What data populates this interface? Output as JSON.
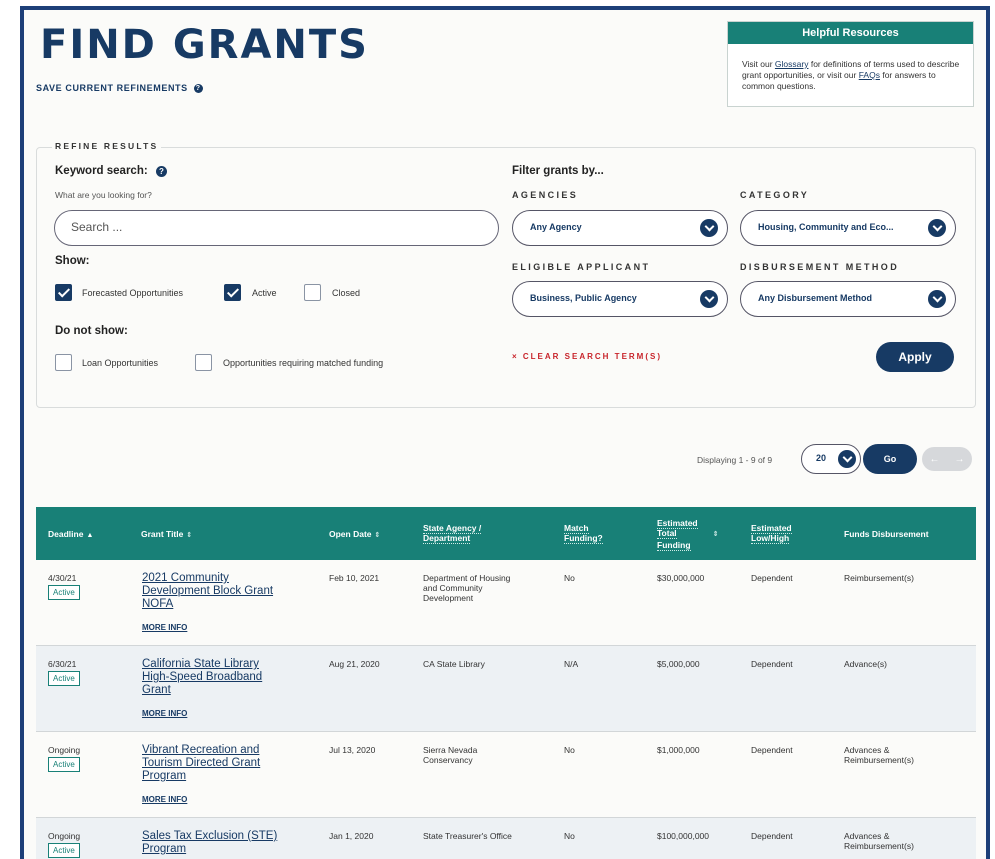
{
  "header": {
    "title": "FIND GRANTS",
    "save_refinements": "SAVE CURRENT REFINEMENTS"
  },
  "resources": {
    "title": "Helpful Resources",
    "text_1": "Visit our ",
    "glossary_link": "Glossary",
    "text_2": " for definitions of terms used to describe grant opportunities, or visit our ",
    "faqs_link": "FAQs",
    "text_3": " for answers to common questions."
  },
  "refine": {
    "legend": "REFINE RESULTS",
    "keyword_label": "Keyword search:",
    "keyword_hint": "What are you looking for?",
    "search_placeholder": "Search ...",
    "show_label": "Show:",
    "show_options": [
      {
        "label": "Forecasted Opportunities",
        "checked": true
      },
      {
        "label": "Active",
        "checked": true
      },
      {
        "label": "Closed",
        "checked": false
      }
    ],
    "do_not_show_label": "Do not show:",
    "do_not_show_options": [
      {
        "label": "Loan Opportunities",
        "checked": false
      },
      {
        "label": "Opportunities requiring matched funding",
        "checked": false
      }
    ],
    "filter_label": "Filter grants by...",
    "agencies_label": "AGENCIES",
    "agencies_value": "Any Agency",
    "category_label": "CATEGORY",
    "category_value": "Housing, Community and Eco...",
    "applicant_label": "ELIGIBLE APPLICANT",
    "applicant_value": "Business, Public Agency",
    "disbursement_label": "DISBURSEMENT METHOD",
    "disbursement_value": "Any Disbursement Method",
    "clear_label": "× CLEAR SEARCH TERM(S)",
    "apply_label": "Apply"
  },
  "pagination": {
    "displaying": "Displaying 1 - 9 of 9",
    "page_size": "20",
    "go_label": "Go",
    "prev": "←",
    "next": "→"
  },
  "table": {
    "headers": {
      "deadline": "Deadline",
      "grant_title": "Grant Title",
      "open_date": "Open Date",
      "agency_1": "State Agency /",
      "agency_2": "Department",
      "match_1": "Match",
      "match_2": "Funding?",
      "funding_1": "Estimated",
      "funding_2": "Total",
      "funding_3": "Funding",
      "lowhigh_1": "Estimated",
      "lowhigh_2": "Low/High",
      "disbursement": "Funds Disbursement"
    },
    "more_info": "MORE INFO",
    "rows": [
      {
        "deadline": "4/30/21",
        "status": "Active",
        "title_lines": [
          "2021 Community",
          "Development Block Grant",
          "NOFA"
        ],
        "open_date": "Feb 10, 2021",
        "agency_lines": [
          "Department of Housing",
          "and Community",
          "Development"
        ],
        "match": "No",
        "funding": "$30,000,000",
        "low_high": "Dependent",
        "disbursement_lines": [
          "Reimbursement(s)"
        ]
      },
      {
        "deadline": "6/30/21",
        "status": "Active",
        "title_lines": [
          "California State Library",
          "High-Speed Broadband",
          "Grant"
        ],
        "open_date": "Aug 21, 2020",
        "agency_lines": [
          "CA State Library"
        ],
        "match": "N/A",
        "funding": "$5,000,000",
        "low_high": "Dependent",
        "disbursement_lines": [
          "Advance(s)"
        ]
      },
      {
        "deadline": "Ongoing",
        "status": "Active",
        "title_lines": [
          "Vibrant Recreation and",
          "Tourism Directed Grant",
          "Program"
        ],
        "open_date": "Jul 13, 2020",
        "agency_lines": [
          "Sierra Nevada",
          "Conservancy"
        ],
        "match": "No",
        "funding": "$1,000,000",
        "low_high": "Dependent",
        "disbursement_lines": [
          "Advances &",
          "Reimbursement(s)"
        ]
      },
      {
        "deadline": "Ongoing",
        "status": "Active",
        "title_lines": [
          "Sales Tax Exclusion (STE)",
          "Program"
        ],
        "open_date": "Jan 1, 2020",
        "agency_lines": [
          "State Treasurer's Office"
        ],
        "match": "No",
        "funding": "$100,000,000",
        "low_high": "Dependent",
        "disbursement_lines": [
          "Advances &",
          "Reimbursement(s)"
        ]
      }
    ]
  },
  "colors": {
    "navy": "#173a64",
    "teal": "#188077",
    "frame": "#1d3f78",
    "clear_red": "#c8242b"
  }
}
